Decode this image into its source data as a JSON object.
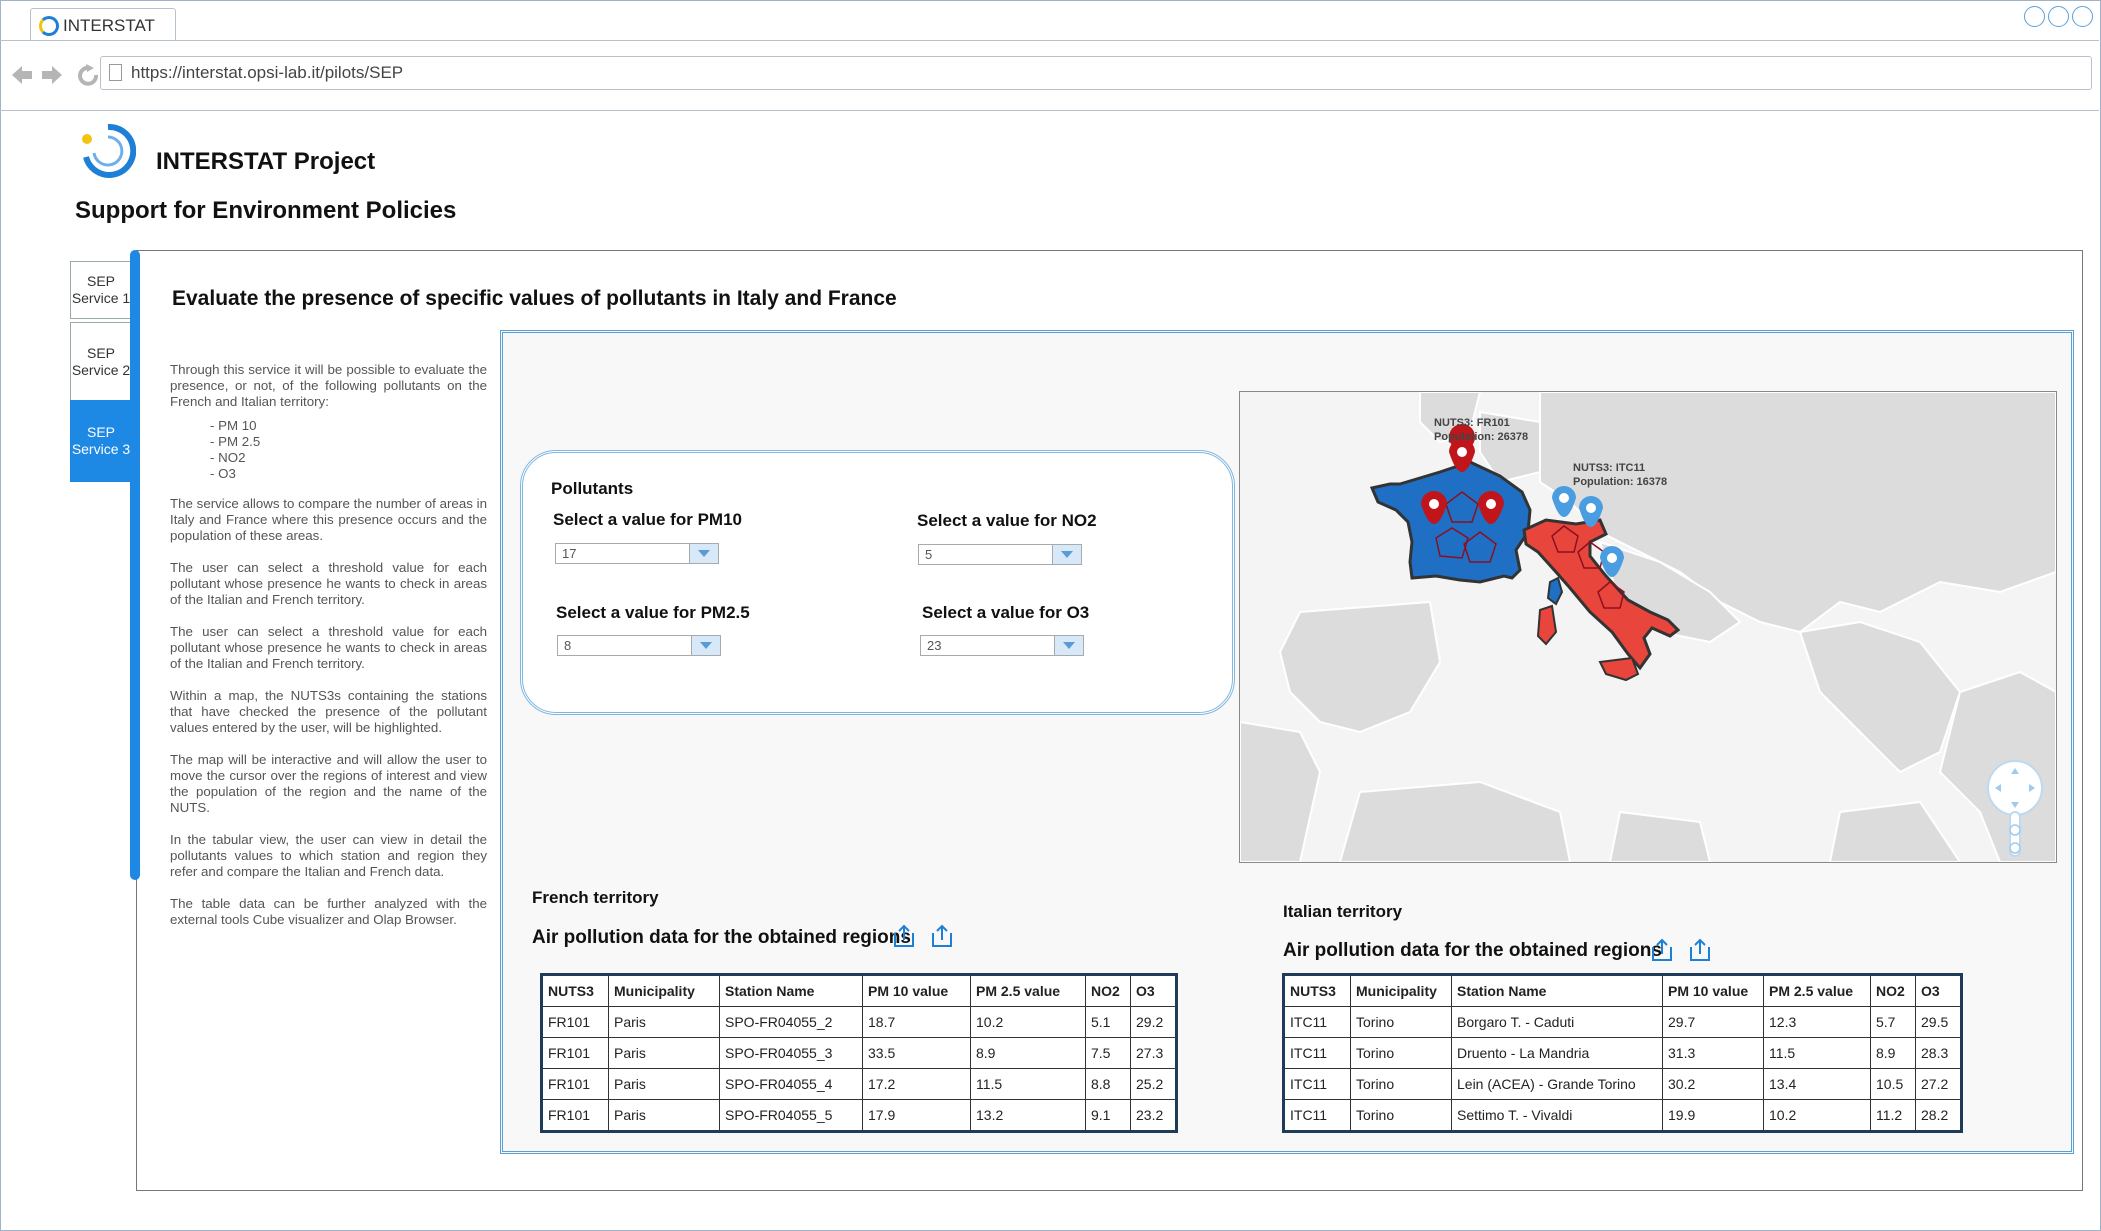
{
  "browser": {
    "tab_title": "INTERSTAT",
    "url": "https://interstat.opsi-lab.it/pilots/SEP"
  },
  "header": {
    "project_title": "INTERSTAT Project",
    "subtitle": "Support for Environment Policies"
  },
  "side_tabs": [
    {
      "line1": "SEP",
      "line2": "Service 1"
    },
    {
      "line1": "SEP",
      "line2": "Service 2"
    },
    {
      "line1": "SEP",
      "line2": "Service 3"
    }
  ],
  "main": {
    "heading": "Evaluate the presence of specific values of pollutants in Italy and France",
    "description": {
      "intro": "Through this service it will be possible to evaluate the presence, or not, of the following pollutants on the French and Italian territory:",
      "pollutants": [
        "- PM 10",
        "- PM 2.5",
        "- NO2",
        "- O3"
      ],
      "p2": "The service allows to compare the number of areas in Italy and France where this presence occurs and the population of these areas.",
      "p3": "The user can select a threshold value for each pollutant whose presence he wants to check in areas of the Italian and French territory.",
      "p4": "The user can select a threshold value for each pollutant whose presence he wants to check in areas of the Italian and French territory.",
      "p5": "Within a map, the NUTS3s containing the stations that have checked the presence of the pollutant values entered by the user, will be highlighted.",
      "p6": "The map will be interactive and will allow the user to move the cursor over the regions of interest and view the population of the region and the name of the NUTS.",
      "p7": "In the tabular view, the user can view in detail the pollutants values to which station and region they refer and compare the Italian and French data.",
      "p8": "The table data can be further analyzed with the external tools Cube visualizer and Olap Browser."
    }
  },
  "pollutants_form": {
    "title": "Pollutants",
    "pm10": {
      "label": "Select a value for PM10",
      "value": "17"
    },
    "no2": {
      "label": "Select a value for NO2",
      "value": "5"
    },
    "pm25": {
      "label": "Select a value for PM2.5",
      "value": "8"
    },
    "o3": {
      "label": "Select a value for O3",
      "value": "23"
    }
  },
  "map": {
    "fr_label_line1": "NUTS3: FR101",
    "fr_label_line2": "Population: 26378",
    "it_label_line1": "NUTS3: ITC11",
    "it_label_line2": "Population: 16378",
    "france_color": "#1f6fc5",
    "italy_color": "#e8453c",
    "fr_marker_color": "#c0151b",
    "it_marker_color": "#4a9de0"
  },
  "french": {
    "territory_title": "French territory",
    "air_title": "Air pollution data for the obtained regions",
    "columns": [
      "NUTS3",
      "Municipality",
      "Station Name",
      "PM 10 value",
      "PM 2.5 value",
      "NO2",
      "O3"
    ],
    "rows": [
      [
        "FR101",
        "Paris",
        "SPO-FR04055_2",
        "18.7",
        "10.2",
        "5.1",
        "29.2"
      ],
      [
        "FR101",
        "Paris",
        "SPO-FR04055_3",
        "33.5",
        "8.9",
        "7.5",
        "27.3"
      ],
      [
        "FR101",
        "Paris",
        "SPO-FR04055_4",
        "17.2",
        "11.5",
        "8.8",
        "25.2"
      ],
      [
        "FR101",
        "Paris",
        "SPO-FR04055_5",
        "17.9",
        "13.2",
        "9.1",
        "23.2"
      ]
    ]
  },
  "italian": {
    "territory_title": "Italian territory",
    "air_title": "Air pollution data for the obtained regions",
    "columns": [
      "NUTS3",
      "Municipality",
      "Station Name",
      "PM 10 value",
      "PM 2.5 value",
      "NO2",
      "O3"
    ],
    "rows": [
      [
        "ITC11",
        "Torino",
        "Borgaro T. - Caduti",
        "29.7",
        "12.3",
        "5.7",
        "29.5"
      ],
      [
        "ITC11",
        "Torino",
        "Druento - La Mandria",
        "31.3",
        "11.5",
        "8.9",
        "28.3"
      ],
      [
        "ITC11",
        "Torino",
        "Lein (ACEA) - Grande Torino",
        "30.2",
        "13.4",
        "10.5",
        "27.2"
      ],
      [
        "ITC11",
        "Torino",
        "Settimo T. - Vivaldi",
        "19.9",
        "10.2",
        "11.2",
        "28.2"
      ]
    ]
  }
}
